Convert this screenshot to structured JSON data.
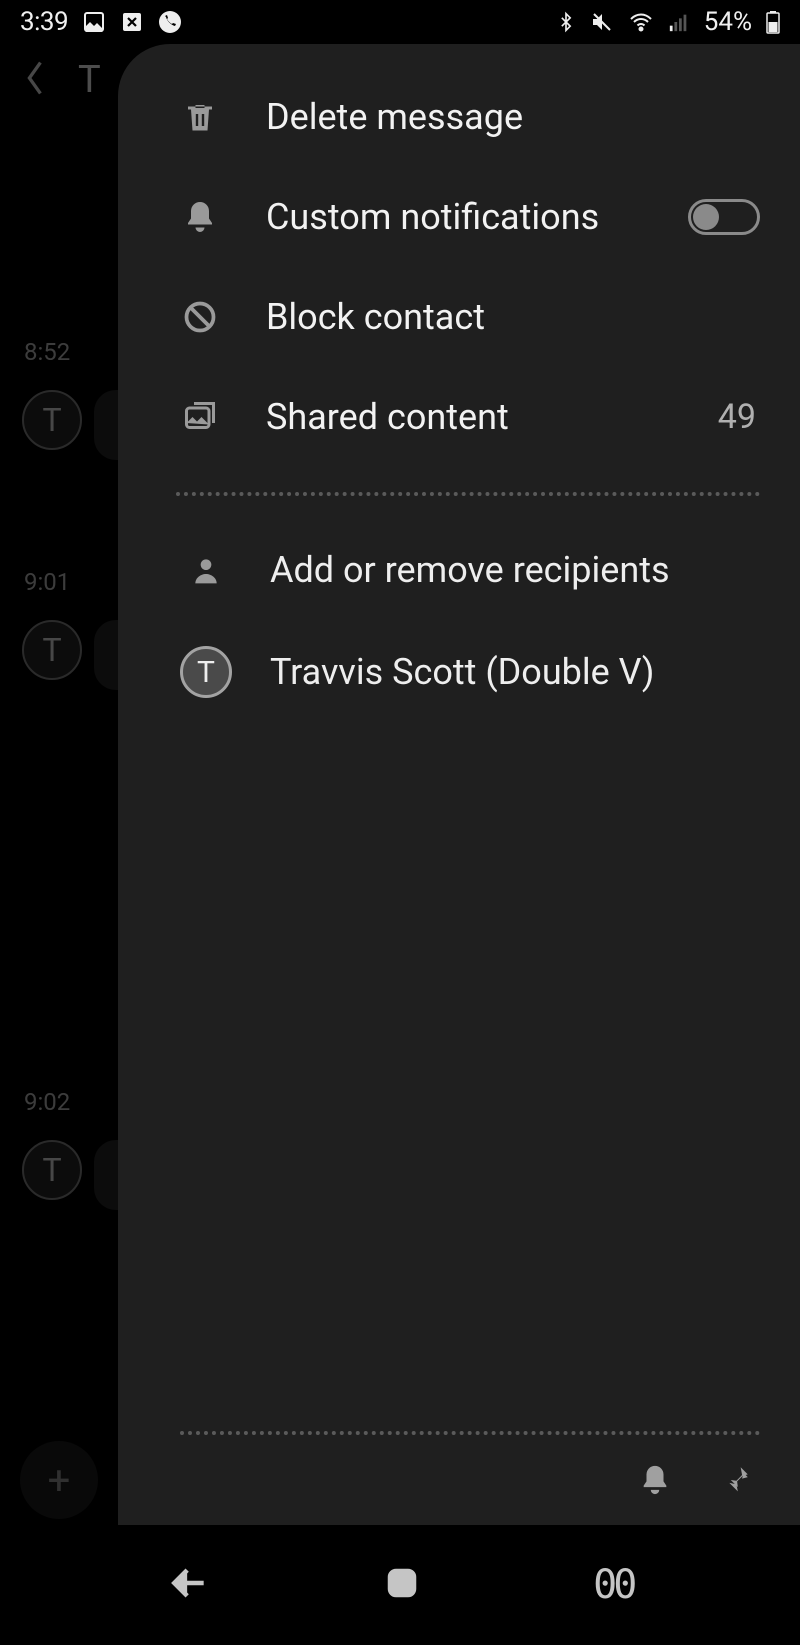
{
  "status_bar": {
    "time": "3:39",
    "battery_pct": "54%"
  },
  "background_chat": {
    "title_initial": "T",
    "avatar_letter": "T",
    "times": [
      "8:52",
      "9:01",
      "9:02"
    ]
  },
  "menu": {
    "delete_label": "Delete message",
    "custom_notifications_label": "Custom notifications",
    "block_contact_label": "Block contact",
    "shared_content_label": "Shared content",
    "shared_content_count": "49",
    "add_remove_label": "Add or remove recipients",
    "recipient_name": "Travvis Scott (Double V)",
    "recipient_initial": "T"
  }
}
